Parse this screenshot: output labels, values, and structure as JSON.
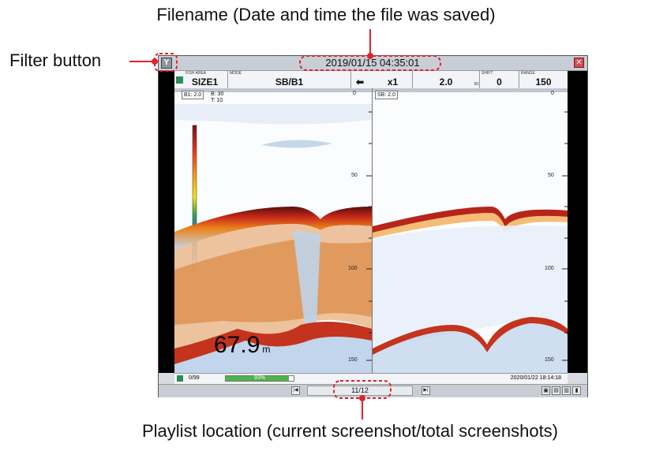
{
  "callouts": {
    "filename": "Filename (Date and time the file was saved)",
    "filter": "Filter button",
    "playlist": "Playlist location (current screenshot/total screenshots)"
  },
  "window": {
    "filename": "2019/01/15 04:35:01",
    "filter_icon": "filter-icon",
    "close_icon": "close-icon"
  },
  "infobar": {
    "fish_area_label": "FISH AREA",
    "fish_area_value": "SIZE1",
    "mode_label": "MODE",
    "mode_value": "SB/B1",
    "speed_value": "x1",
    "gain_value": "2.0",
    "gain_suffix": "B1",
    "shift_label": "SHIFT",
    "shift_value": "0",
    "range_label": "RANGE",
    "range_value": "150"
  },
  "panels": {
    "left_tag": "B1: 2.0",
    "left_tag2": "B: 30",
    "left_tag3": "T: 10",
    "right_tag": "SB: 2.0",
    "depth_labels": [
      "0",
      "50",
      "100",
      "150"
    ],
    "depth_value": "67.9",
    "depth_unit": "m"
  },
  "status": {
    "count": "0/99",
    "progress_text": "93%",
    "progress": 0.93,
    "timestamp": "2020/01/22 18:14:18"
  },
  "nav": {
    "playlist": "11/12"
  },
  "colors": {
    "callout_red": "#e1232d",
    "progress_green": "#4cb548"
  }
}
